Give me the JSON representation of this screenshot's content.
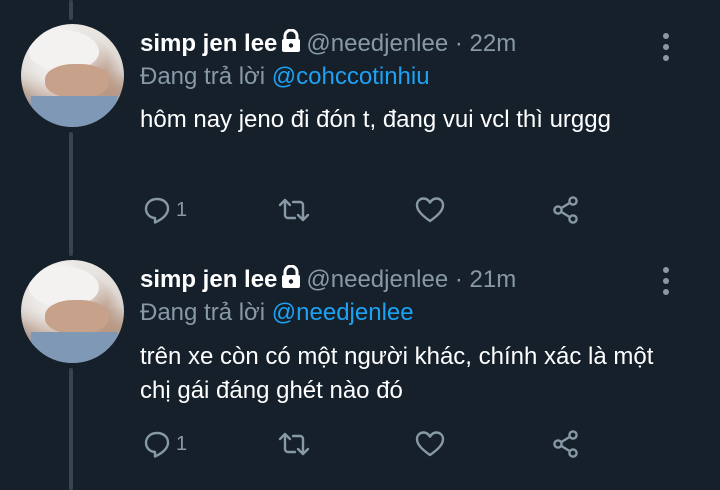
{
  "tweets": [
    {
      "display_name": "simp jen lee",
      "handle": "@needjenlee",
      "separator": "·",
      "time": "22m",
      "reply_prefix": "Đang trả lời",
      "reply_to": "@cohccotinhiu",
      "text": "hôm nay jeno đi đón t, đang vui vcl thì urggg",
      "reply_count": "1"
    },
    {
      "display_name": "simp jen lee",
      "handle": "@needjenlee",
      "separator": "·",
      "time": "21m",
      "reply_prefix": "Đang trả lời",
      "reply_to": "@needjenlee",
      "text": "trên xe còn có một người khác, chính xác là một chị gái đáng ghét nào đó",
      "reply_count": "1"
    }
  ],
  "icons": {
    "lock": "lock-icon",
    "more": "more-vertical-icon",
    "reply": "reply-icon",
    "retweet": "retweet-icon",
    "like": "heart-icon",
    "share": "share-icon"
  },
  "colors": {
    "background": "#15202b",
    "secondary_text": "#8899a6",
    "link": "#1da1f2",
    "thread_line": "#38444d"
  }
}
